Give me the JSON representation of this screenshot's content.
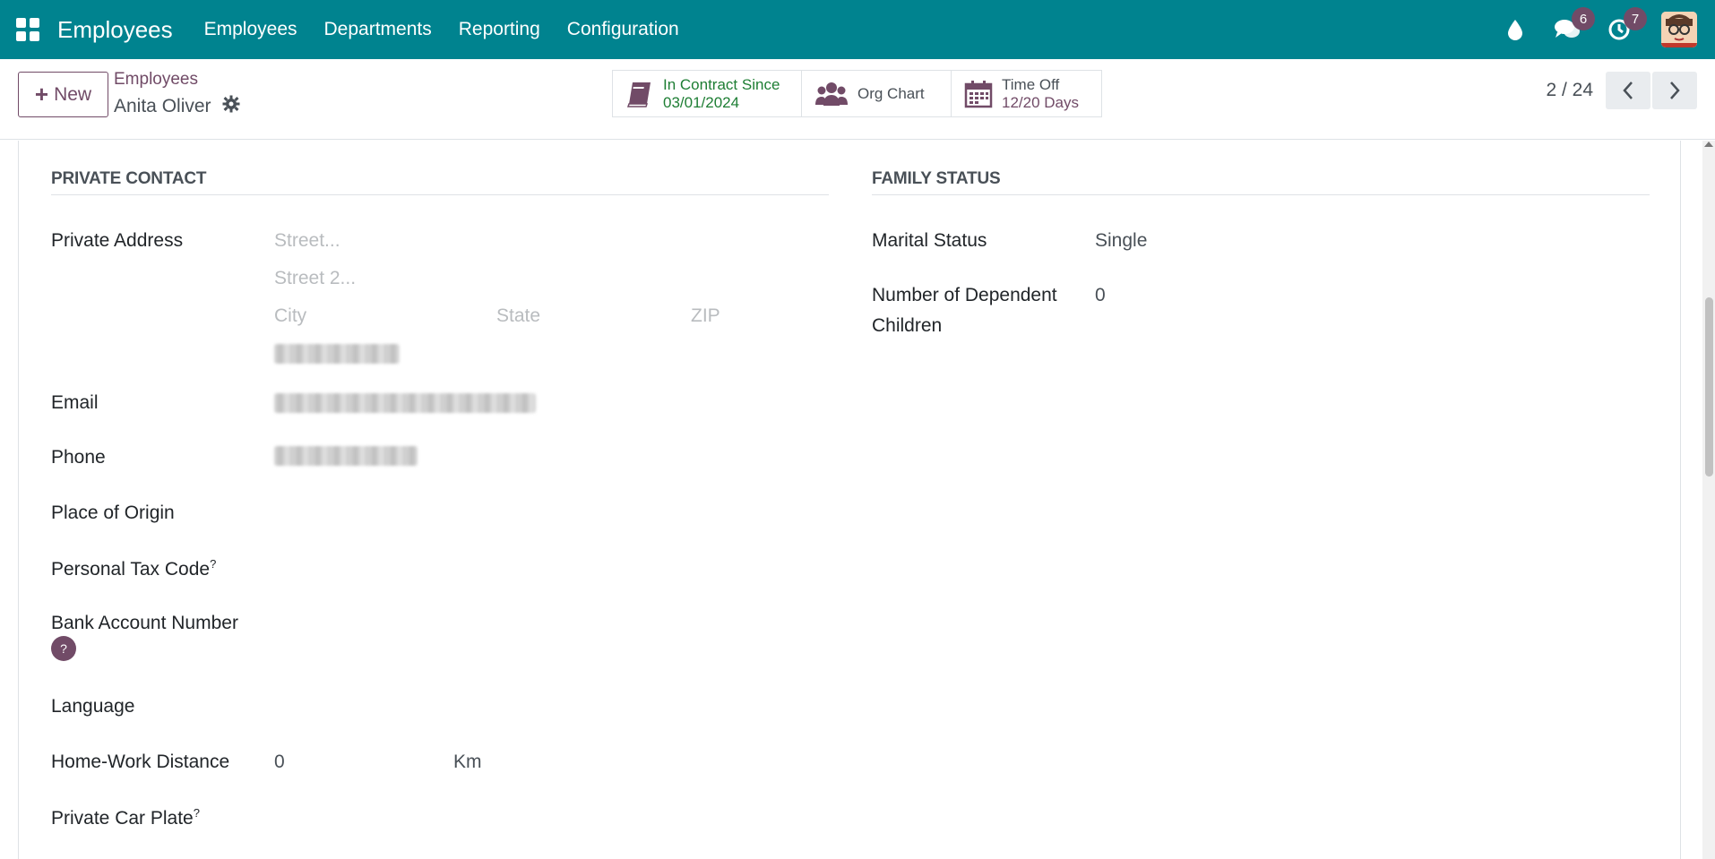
{
  "navbar": {
    "app_title": "Employees",
    "menu": [
      "Employees",
      "Departments",
      "Reporting",
      "Configuration"
    ],
    "messages_count": "6",
    "activities_count": "7",
    "icons": [
      "apps-grid-icon",
      "drop-icon",
      "chat-icon",
      "clock-icon",
      "user-avatar"
    ]
  },
  "control": {
    "new_label": "New",
    "breadcrumb": "Employees",
    "record_name": "Anita Oliver",
    "smart_buttons": {
      "contract_title": "In Contract Since",
      "contract_value": "03/01/2024",
      "org_chart": "Org Chart",
      "timeoff_title": "Time Off",
      "timeoff_value": "12/20 Days"
    },
    "pager": "2 / 24"
  },
  "private_contact": {
    "title": "PRIVATE CONTACT",
    "private_address_label": "Private Address",
    "street_placeholder": "Street...",
    "street2_placeholder": "Street 2...",
    "city_placeholder": "City",
    "state_placeholder": "State",
    "zip_placeholder": "ZIP",
    "email_label": "Email",
    "phone_label": "Phone",
    "place_of_origin_label": "Place of Origin",
    "personal_tax_code_label": "Personal Tax Code",
    "bank_account_label": "Bank Account Number",
    "language_label": "Language",
    "home_work_distance_label": "Home-Work Distance",
    "home_work_distance_value": "0",
    "distance_unit": "Km",
    "private_car_plate_label": "Private Car Plate",
    "help_mark": "?"
  },
  "family_status": {
    "title": "FAMILY STATUS",
    "marital_status_label": "Marital Status",
    "marital_status_value": "Single",
    "dependent_children_label_1": "Number of Dependent",
    "dependent_children_label_2": "Children",
    "dependent_children_value": "0"
  },
  "colors": {
    "navbar": "#00838f",
    "accent": "#714b67",
    "contract_green": "#1e7e34"
  }
}
